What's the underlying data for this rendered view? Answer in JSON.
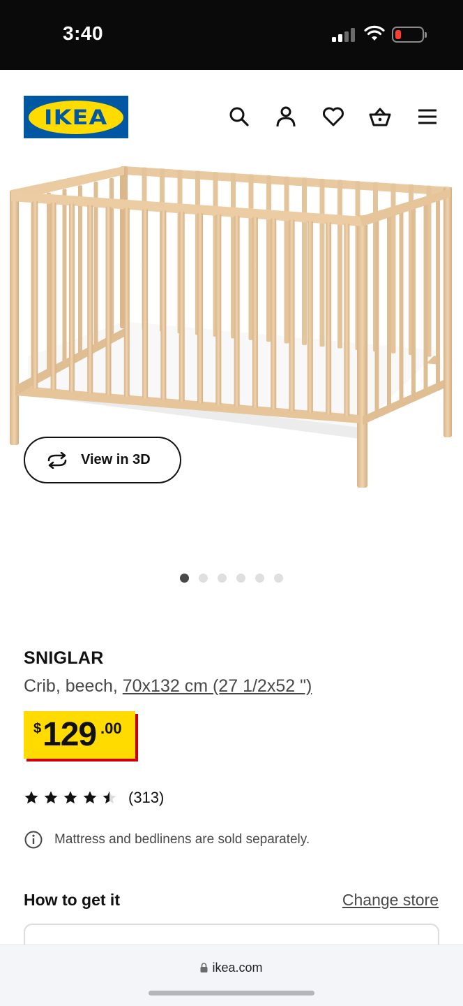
{
  "status_bar": {
    "time": "3:40",
    "icons": [
      "cellular-signal-icon",
      "wifi-icon",
      "battery-low-icon"
    ],
    "battery_color": "#ff3b30"
  },
  "header": {
    "logo_text": "IKEA",
    "icons": [
      "search-icon",
      "account-icon",
      "heart-icon",
      "cart-icon",
      "menu-icon"
    ],
    "brand_blue": "#0058a3",
    "brand_yellow": "#ffdb00"
  },
  "gallery": {
    "view_3d_label": "View in 3D",
    "image_count": 6,
    "active_index": 0
  },
  "product": {
    "name": "SNIGLAR",
    "description_prefix": "Crib, beech, ",
    "size": "70x132 cm (27 1/2x52 \")",
    "price_currency": "$",
    "price_main": "129",
    "price_cents": ".00",
    "price_bg": "#ffdb00",
    "rating": 4.5,
    "rating_max": 5,
    "review_count": "(313)",
    "notice": "Mattress and bedlinens are sold separately."
  },
  "fulfillment": {
    "title": "How to get it",
    "change_store_label": "Change store"
  },
  "browser": {
    "url": "ikea.com"
  }
}
